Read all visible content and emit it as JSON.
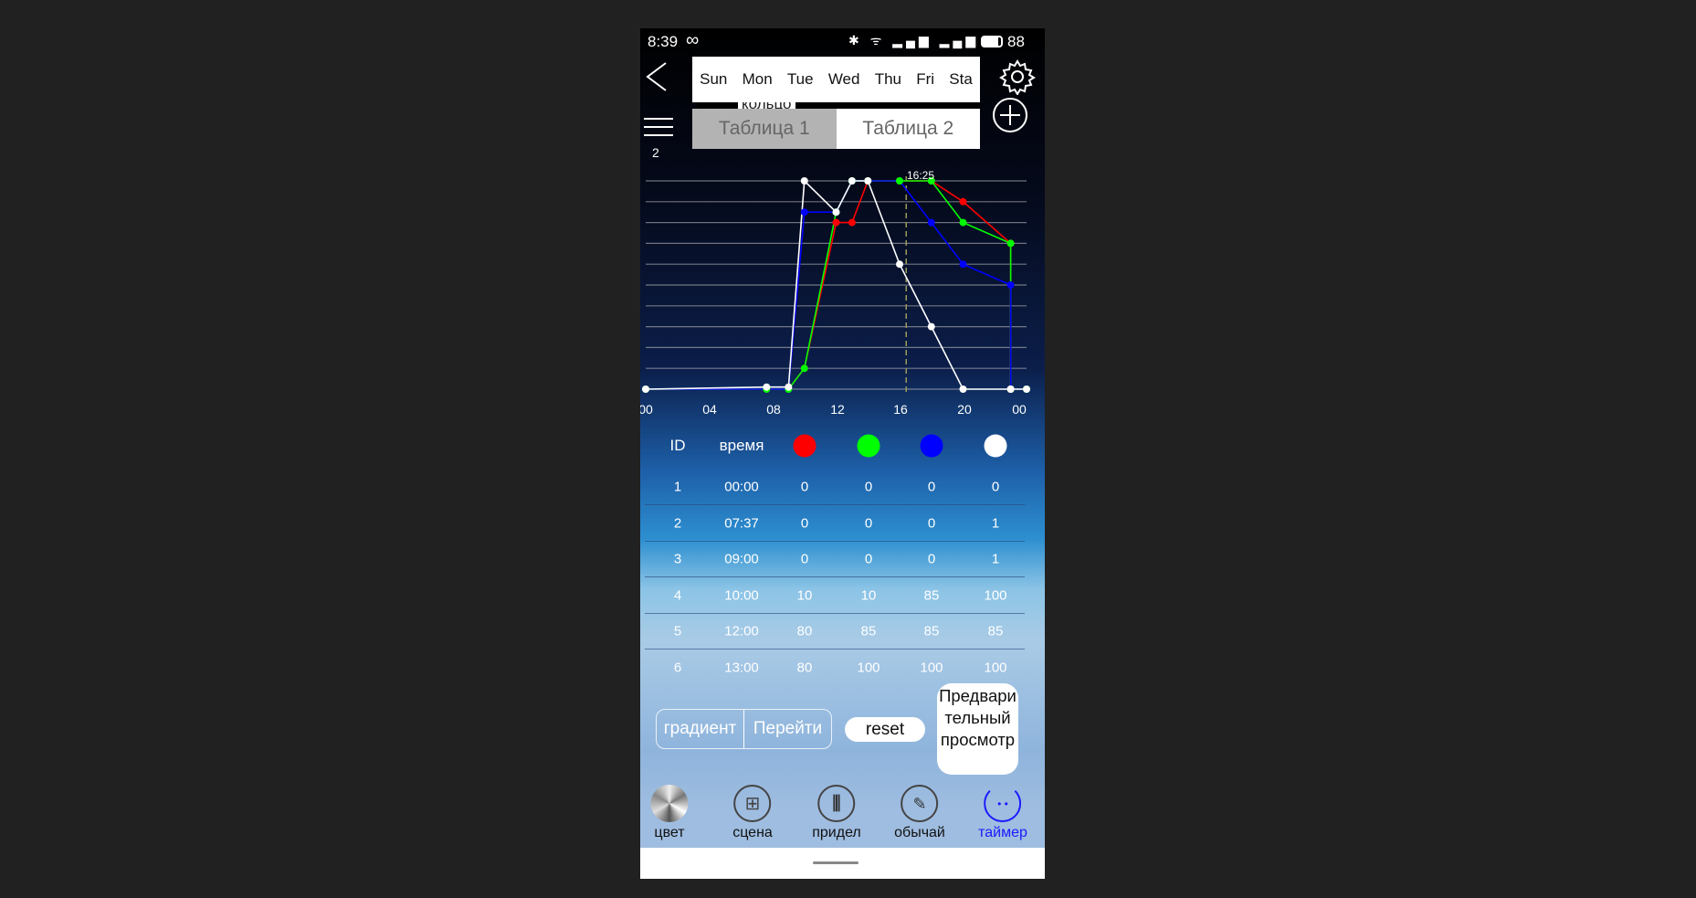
{
  "status_bar": {
    "time": "8:39",
    "battery": "88",
    "icons": [
      "infinity-icon",
      "bluetooth-icon",
      "wifi-icon",
      "signal-icon",
      "4g-lte-icon",
      "signal-icon",
      "4g-lte-icon",
      "battery-icon"
    ]
  },
  "header": {
    "days": [
      "Sun",
      "Mon",
      "Tue",
      "Wed",
      "Thu",
      "Fri",
      "Sta"
    ],
    "hidden_label": "кольцо",
    "tables": [
      "Таблица 1",
      "Таблица 2"
    ],
    "active_table": 0,
    "menu_count": "2"
  },
  "chart_data": {
    "type": "line",
    "x_unit": "hour",
    "xlim": [
      0,
      24
    ],
    "ylim": [
      0,
      100
    ],
    "grid": true,
    "x_tick_labels": [
      "00",
      "04",
      "08",
      "12",
      "16",
      "20",
      "00"
    ],
    "x_ticks": [
      0,
      4,
      8,
      12,
      16,
      20,
      24
    ],
    "current_time_label": "16:25",
    "current_time": 16.4167,
    "x": [
      0,
      7.617,
      9,
      10,
      12,
      13,
      14,
      16,
      18,
      20,
      23,
      23,
      24
    ],
    "series": [
      {
        "color": "#ff0000",
        "values": [
          0,
          0,
          0,
          10,
          80,
          80,
          100,
          100,
          100,
          90,
          70,
          0,
          0
        ]
      },
      {
        "color": "#00ff00",
        "values": [
          0,
          0,
          0,
          10,
          85,
          100,
          100,
          100,
          100,
          80,
          70,
          0,
          0
        ]
      },
      {
        "color": "#0000ff",
        "values": [
          0,
          0,
          0,
          85,
          85,
          100,
          100,
          100,
          80,
          60,
          50,
          0,
          0
        ]
      },
      {
        "color": "#ffffff",
        "values": [
          0,
          1,
          1,
          100,
          85,
          100,
          100,
          60,
          30,
          0,
          0,
          0,
          0
        ]
      }
    ]
  },
  "table": {
    "headers": [
      "ID",
      "время"
    ],
    "channel_colors": [
      "#ff0000",
      "#00ff00",
      "#0000ff",
      "#ffffff"
    ],
    "rows": [
      [
        "1",
        "00:00",
        "0",
        "0",
        "0",
        "0"
      ],
      [
        "2",
        "07:37",
        "0",
        "0",
        "0",
        "1"
      ],
      [
        "3",
        "09:00",
        "0",
        "0",
        "0",
        "1"
      ],
      [
        "4",
        "10:00",
        "10",
        "10",
        "85",
        "100"
      ],
      [
        "5",
        "12:00",
        "80",
        "85",
        "85",
        "85"
      ],
      [
        "6",
        "13:00",
        "80",
        "100",
        "100",
        "100"
      ]
    ]
  },
  "actions": {
    "gradient": "градиент",
    "goto": "Перейти",
    "reset": "reset",
    "preview": "Предварительный просмотр"
  },
  "nav": [
    {
      "label": "цвет",
      "icon": "color-wheel-icon"
    },
    {
      "label": "сцена",
      "icon": "scene-grid-icon"
    },
    {
      "label": "придел",
      "icon": "sliders-icon"
    },
    {
      "label": "обычай",
      "icon": "edit-icon"
    },
    {
      "label": "таймер",
      "icon": "timer-icon",
      "active": true
    }
  ],
  "accent": "#1a1aff"
}
